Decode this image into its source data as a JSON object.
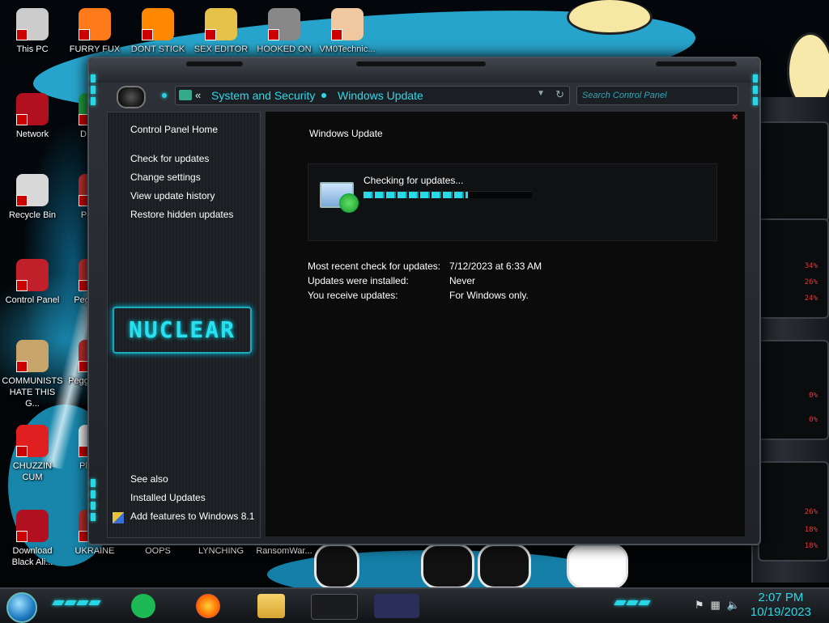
{
  "desktop": {
    "icons": [
      {
        "label": "This PC",
        "icon": "computer-icon",
        "color": "#cccccc"
      },
      {
        "label": "FURRY FUX",
        "icon": "firefox-icon",
        "color": "#ff7a1a"
      },
      {
        "label": "DONT STICK",
        "icon": "vlc-icon",
        "color": "#ff8800"
      },
      {
        "label": "SEX EDITOR",
        "icon": "hxd-icon",
        "color": "#e7c24a"
      },
      {
        "label": "HOOKED ON",
        "icon": "game-icon",
        "color": "#888888"
      },
      {
        "label": "VM0Technic...",
        "icon": "doctor-icon",
        "color": "#f0c8a0"
      },
      {
        "label": "Network",
        "icon": "network-globe-icon",
        "color": "#b01020"
      },
      {
        "label": "Recycle Bin",
        "icon": "recycle-bin-icon",
        "color": "#d8d8d8"
      },
      {
        "label": "Control Panel",
        "icon": "control-panel-icon",
        "color": "#c0202a"
      },
      {
        "label": "COMMUNISTS HATE THIS G...",
        "icon": "money-bag-icon",
        "color": "#c7a46a"
      },
      {
        "label": "CHUZZIN CUM",
        "icon": "chuzzle-icon",
        "color": "#e02020"
      },
      {
        "label": "Download Black Ali...",
        "icon": "network-globe-icon",
        "color": "#b01020"
      },
      {
        "label": "UKRAINE",
        "icon": "peggle-icon",
        "color": "#c03030"
      },
      {
        "label": "OOPS",
        "icon": "app-icon",
        "color": "#333333"
      },
      {
        "label": "LYNCHING",
        "icon": "app-icon",
        "color": "#333333"
      },
      {
        "label": "RansomWar...",
        "icon": "app-icon",
        "color": "#333333"
      },
      {
        "label": "D DUM",
        "icon": "app-icon",
        "color": "#20a040"
      },
      {
        "label": "Peggle",
        "icon": "peggle-icon",
        "color": "#c03030"
      },
      {
        "label": "Peggle De",
        "icon": "peggle-icon",
        "color": "#c03030"
      },
      {
        "label": "Peggle of Wa",
        "icon": "peggle-icon",
        "color": "#c03030"
      },
      {
        "label": "Plan Zo",
        "icon": "flower-icon",
        "color": "#f0f0f0"
      }
    ]
  },
  "gadgets": {
    "percents": [
      "34%",
      "26%",
      "24%",
      "0%",
      "0%",
      "26%",
      "18%",
      "18%"
    ]
  },
  "window": {
    "breadcrumb": {
      "back": "«",
      "items": [
        "System and Security",
        "Windows Update"
      ]
    },
    "search_placeholder": "Search Control Panel",
    "sidebar": {
      "home": "Control Panel Home",
      "links": [
        "Check for updates",
        "Change settings",
        "View update history",
        "Restore hidden updates"
      ],
      "brand": "NUCLEAR",
      "see_also_title": "See also",
      "see_also": [
        "Installed Updates",
        "Add features to Windows 8.1"
      ]
    },
    "main": {
      "title": "Windows Update",
      "status_text": "Checking for updates...",
      "progress_fraction": 0.62,
      "details": [
        {
          "label": "Most recent check for updates:",
          "value": "7/12/2023 at 6:33 AM"
        },
        {
          "label": "Updates were installed:",
          "value": "Never"
        },
        {
          "label": "You receive updates:",
          "value": "For Windows only."
        }
      ]
    }
  },
  "taskbar": {
    "apps": [
      "spotify-icon",
      "firefox-icon",
      "file-explorer-icon",
      "control-panel-icon",
      "window-icon"
    ],
    "clock_time": "2:07 PM",
    "clock_date": "10/19/2023"
  },
  "colors": {
    "accent": "#27d7e5",
    "alert": "#e22222"
  }
}
